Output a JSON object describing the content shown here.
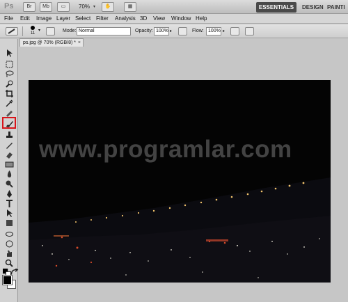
{
  "appbar": {
    "logo": "Ps",
    "btn_br": "Br",
    "btn_mb": "Mb",
    "zoom": "70%",
    "workspaces": [
      "ESSENTIALS",
      "DESIGN",
      "PAINTI"
    ]
  },
  "menu": [
    "File",
    "Edit",
    "Image",
    "Layer",
    "Select",
    "Filter",
    "Analysis",
    "3D",
    "View",
    "Window",
    "Help"
  ],
  "options": {
    "brush_size": "11",
    "mode_label": "Mode:",
    "mode_value": "Normal",
    "opacity_label": "Opacity:",
    "opacity_value": "100%",
    "flow_label": "Flow:",
    "flow_value": "100%"
  },
  "document": {
    "tab_title": "ps.jpg @ 70% (RGB/8) *",
    "close": "×"
  },
  "canvas": {
    "watermark": "www.programlar.com"
  },
  "tools": [
    "move",
    "marquee",
    "lasso",
    "quick-selection",
    "crop",
    "eyedropper",
    "healing-brush",
    "brush",
    "clone-stamp",
    "history-brush",
    "eraser",
    "gradient",
    "blur",
    "dodge",
    "pen",
    "type",
    "path-selection",
    "shape",
    "3d-rotate",
    "3d-orbit",
    "hand",
    "zoom"
  ],
  "colors": {
    "foreground": "#000000",
    "background": "#ffffff",
    "highlight": "#d8141a"
  }
}
